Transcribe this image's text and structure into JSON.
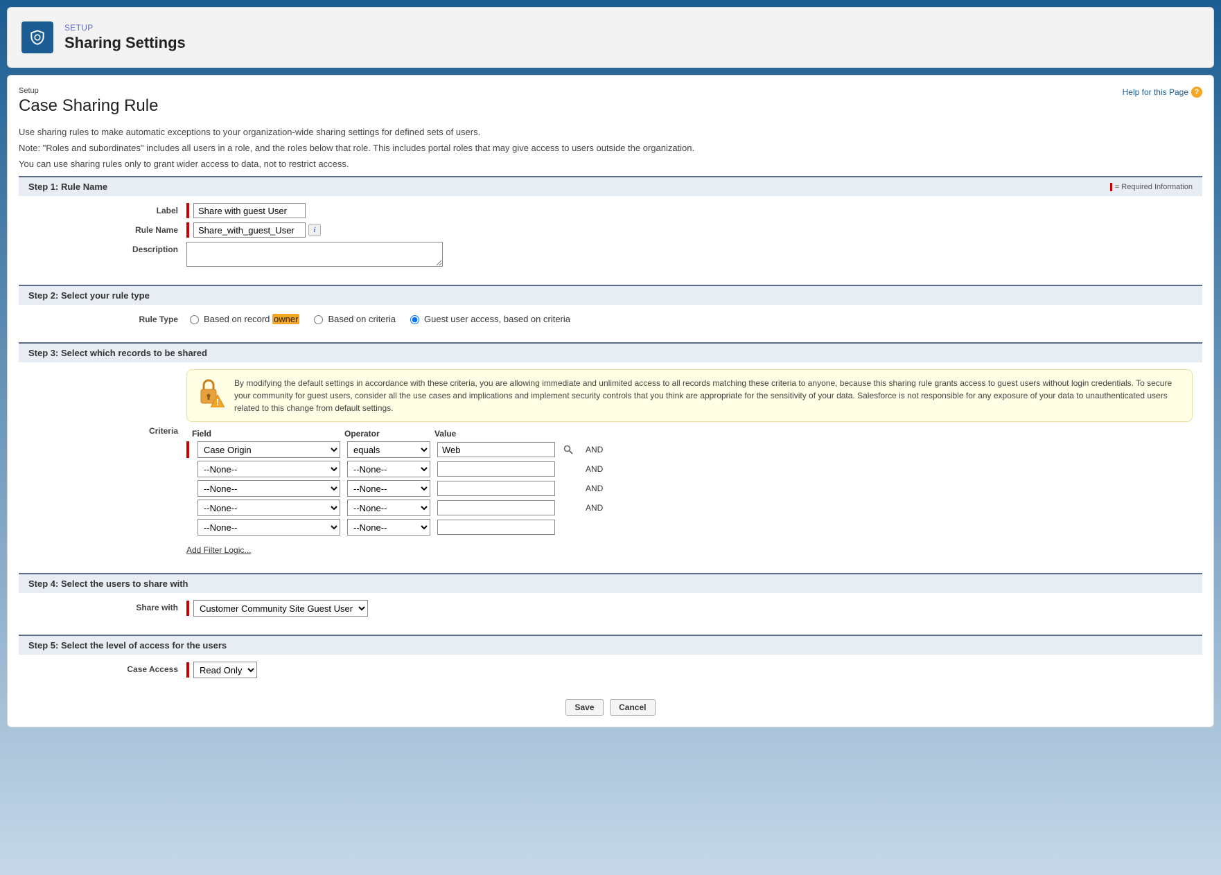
{
  "header": {
    "breadcrumb": "SETUP",
    "title": "Sharing Settings"
  },
  "page": {
    "crumb": "Setup",
    "title": "Case Sharing Rule",
    "help_link": "Help for this Page"
  },
  "intro": {
    "line1": "Use sharing rules to make automatic exceptions to your organization-wide sharing settings for defined sets of users.",
    "line2": "Note: \"Roles and subordinates\" includes all users in a role, and the roles below that role. This includes portal roles that may give access to users outside the organization.",
    "line3": "You can use sharing rules only to grant wider access to data, not to restrict access."
  },
  "required_text": "= Required Information",
  "step1": {
    "header": "Step 1: Rule Name",
    "label_field_label": "Label",
    "label_value": "Share with guest User",
    "rulename_label": "Rule Name",
    "rulename_value": "Share_with_guest_User",
    "description_label": "Description",
    "description_value": ""
  },
  "step2": {
    "header": "Step 2: Select your rule type",
    "ruletype_label": "Rule Type",
    "option1_prefix": "Based on record ",
    "option1_highlight": "owner",
    "option2": "Based on criteria",
    "option3": "Guest user access, based on criteria"
  },
  "step3": {
    "header": "Step 3: Select which records to be shared",
    "criteria_label": "Criteria",
    "warning": "By modifying the default settings in accordance with these criteria, you are allowing immediate and unlimited access to all records matching these criteria to anyone, because this sharing rule grants access to guest users without login credentials. To secure your community for guest users, consider all the use cases and implications and implement security controls that you think are appropriate for the sensitivity of your data. Salesforce is not responsible for any exposure of your data to unauthenticated users related to this change from default settings.",
    "columns": {
      "field": "Field",
      "operator": "Operator",
      "value": "Value"
    },
    "rows": [
      {
        "field": "Case Origin",
        "operator": "equals",
        "value": "Web",
        "lookup": true,
        "and": "AND"
      },
      {
        "field": "--None--",
        "operator": "--None--",
        "value": "",
        "lookup": false,
        "and": "AND"
      },
      {
        "field": "--None--",
        "operator": "--None--",
        "value": "",
        "lookup": false,
        "and": "AND"
      },
      {
        "field": "--None--",
        "operator": "--None--",
        "value": "",
        "lookup": false,
        "and": "AND"
      },
      {
        "field": "--None--",
        "operator": "--None--",
        "value": "",
        "lookup": false,
        "and": ""
      }
    ],
    "add_filter_link": "Add Filter Logic..."
  },
  "step4": {
    "header": "Step 4: Select the users to share with",
    "sharewith_label": "Share with",
    "sharewith_value": "Customer Community Site Guest User"
  },
  "step5": {
    "header": "Step 5: Select the level of access for the users",
    "caseaccess_label": "Case Access",
    "caseaccess_value": "Read Only"
  },
  "buttons": {
    "save": "Save",
    "cancel": "Cancel"
  }
}
